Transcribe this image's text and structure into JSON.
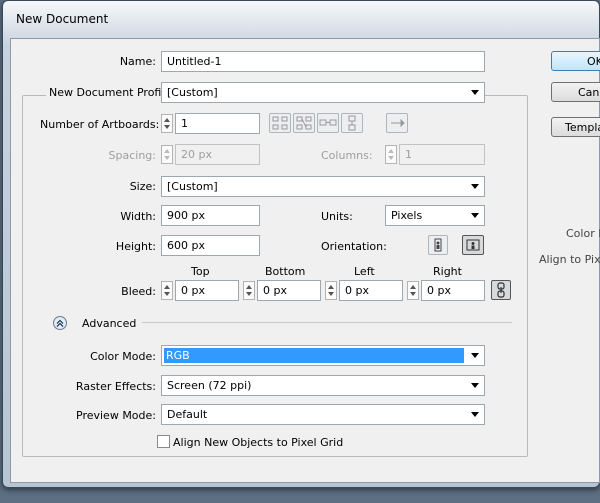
{
  "window": {
    "title": "New Document"
  },
  "name": {
    "label": "Name:",
    "value": "Untitled-1"
  },
  "profile": {
    "label": "New Document Profile:",
    "value": "[Custom]"
  },
  "artboards": {
    "label": "Number of Artboards:",
    "value": "1"
  },
  "spacing": {
    "label": "Spacing:",
    "value": "20 px"
  },
  "columns": {
    "label": "Columns:",
    "value": "1"
  },
  "size": {
    "label": "Size:",
    "value": "[Custom]"
  },
  "width": {
    "label": "Width:",
    "value": "900 px"
  },
  "height": {
    "label": "Height:",
    "value": "600 px"
  },
  "units": {
    "label": "Units:",
    "value": "Pixels"
  },
  "orientation": {
    "label": "Orientation:",
    "selected": "landscape"
  },
  "bleed": {
    "label": "Bleed:",
    "top": {
      "label": "Top",
      "value": "0 px"
    },
    "bottom": {
      "label": "Bottom",
      "value": "0 px"
    },
    "left": {
      "label": "Left",
      "value": "0 px"
    },
    "right": {
      "label": "Right",
      "value": "0 px"
    }
  },
  "advanced": {
    "label": "Advanced",
    "color_mode": {
      "label": "Color Mode:",
      "value": "RGB"
    },
    "raster_effects": {
      "label": "Raster Effects:",
      "value": "Screen (72 ppi)"
    },
    "preview_mode": {
      "label": "Preview Mode:",
      "value": "Default"
    },
    "align_pixel_grid": {
      "label": "Align New Objects to Pixel Grid",
      "checked": false
    }
  },
  "buttons": {
    "ok": "OK",
    "cancel": "Cancel",
    "templates": "Templates..."
  },
  "side_info": {
    "color_mode": "Color M",
    "align": "Align to Pixel"
  },
  "colors": {
    "highlight": "#3399ff",
    "title_bar": "#c9d3de",
    "dialog": "#f0f0f0"
  }
}
